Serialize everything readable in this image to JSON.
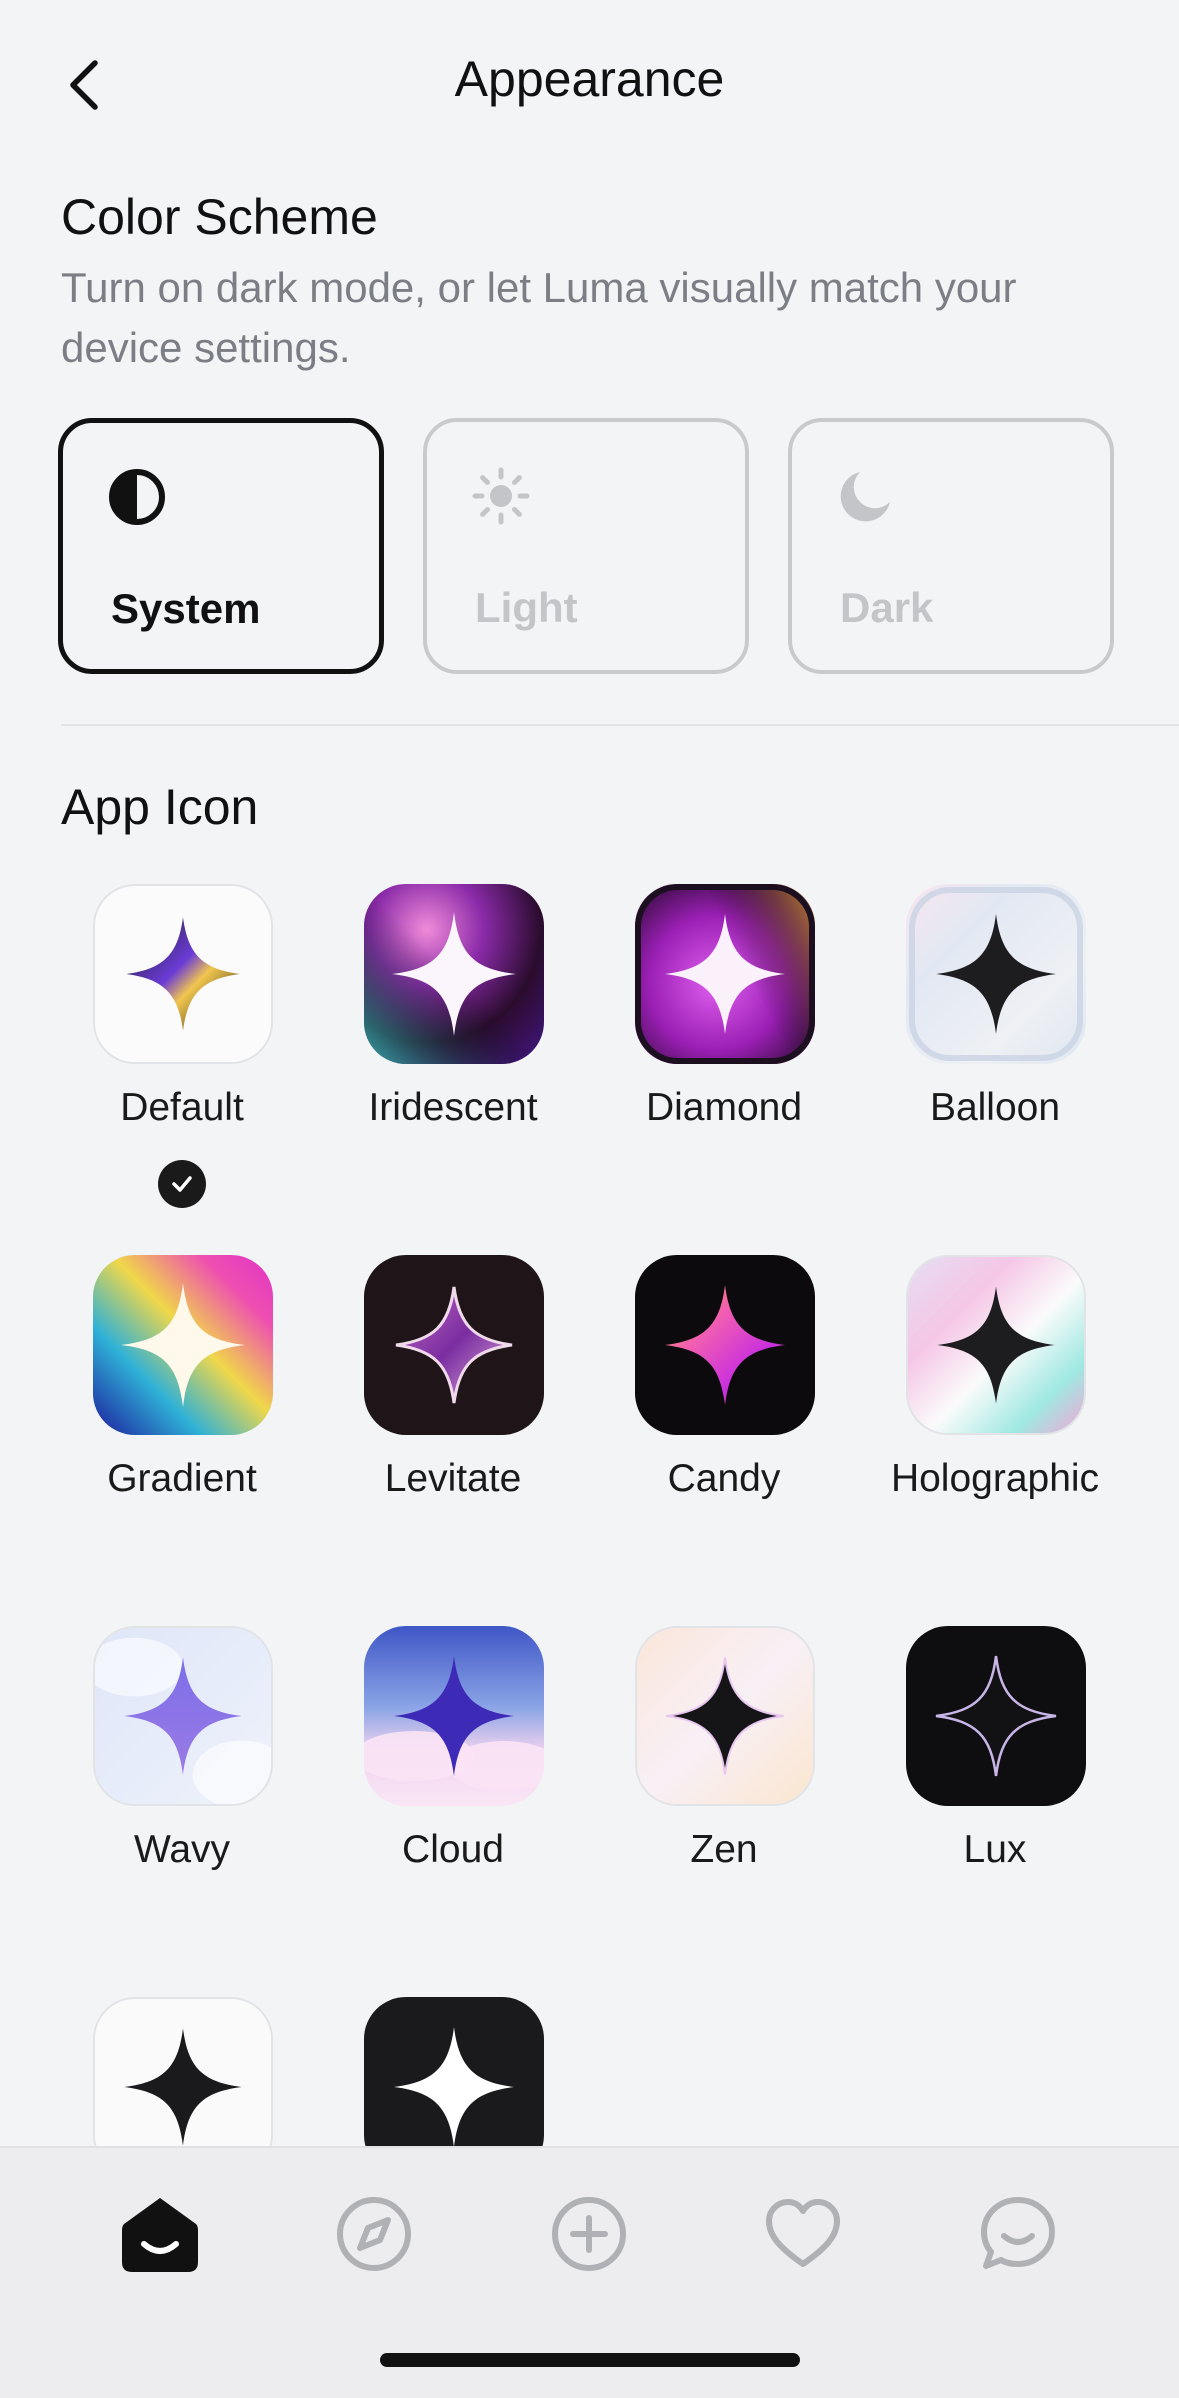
{
  "header": {
    "title": "Appearance",
    "back_icon": "chevron-left-icon"
  },
  "color_scheme": {
    "title": "Color Scheme",
    "description": "Turn on dark mode, or let Luma visually match your device settings.",
    "options": [
      {
        "label": "System",
        "icon": "half-circle-icon",
        "selected": true
      },
      {
        "label": "Light",
        "icon": "sun-icon",
        "selected": false
      },
      {
        "label": "Dark",
        "icon": "moon-icon",
        "selected": false
      }
    ]
  },
  "app_icon": {
    "title": "App Icon",
    "icons": [
      {
        "label": "Default",
        "selected": true
      },
      {
        "label": "Iridescent"
      },
      {
        "label": "Diamond"
      },
      {
        "label": "Balloon"
      },
      {
        "label": "Gradient"
      },
      {
        "label": "Levitate"
      },
      {
        "label": "Candy"
      },
      {
        "label": "Holographic"
      },
      {
        "label": "Wavy"
      },
      {
        "label": "Cloud"
      },
      {
        "label": "Zen"
      },
      {
        "label": "Lux"
      }
    ]
  },
  "tabbar": {
    "items": [
      {
        "name": "home",
        "icon": "home-icon",
        "active": true
      },
      {
        "name": "explore",
        "icon": "compass-icon",
        "active": false
      },
      {
        "name": "create",
        "icon": "plus-circle-icon",
        "active": false
      },
      {
        "name": "favorites",
        "icon": "heart-icon",
        "active": false
      },
      {
        "name": "chat",
        "icon": "chat-bubble-icon",
        "active": false
      }
    ]
  }
}
